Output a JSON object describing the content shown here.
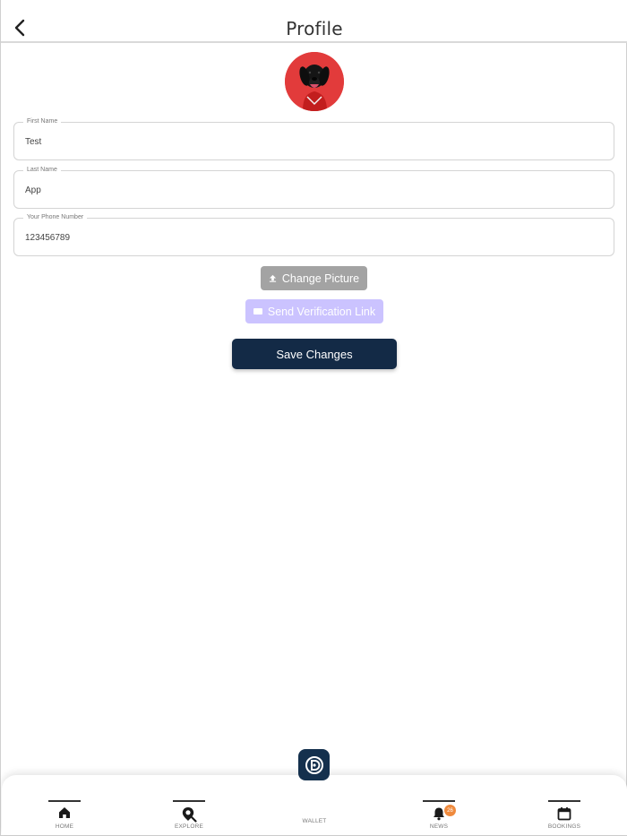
{
  "header": {
    "title": "Profile"
  },
  "avatar": {
    "alt": "profile-picture"
  },
  "form": {
    "first_name": {
      "label": "First Name",
      "value": "Test"
    },
    "last_name": {
      "label": "Last Name",
      "value": "App"
    },
    "phone": {
      "label": "Your Phone Number",
      "value": "123456789"
    }
  },
  "actions": {
    "change_picture": "Change Picture",
    "send_verification": "Send Verification Link",
    "save_changes": "Save Changes"
  },
  "nav": {
    "items": [
      {
        "label": "HOME",
        "icon": "home-icon"
      },
      {
        "label": "EXPLORE",
        "icon": "map-pin-search-icon"
      },
      {
        "label": "WALLET",
        "icon": "wallet-icon"
      },
      {
        "label": "NEWS",
        "icon": "bell-icon",
        "badge": "26"
      },
      {
        "label": "BOOKINGS",
        "icon": "calendar-icon"
      }
    ]
  },
  "colors": {
    "primary": "#132a46",
    "change_picture_bg": "#a3a3a3",
    "verify_bg": "#cbc3ff",
    "badge": "#ef8a3d",
    "avatar_bg": "#e23b3b"
  }
}
